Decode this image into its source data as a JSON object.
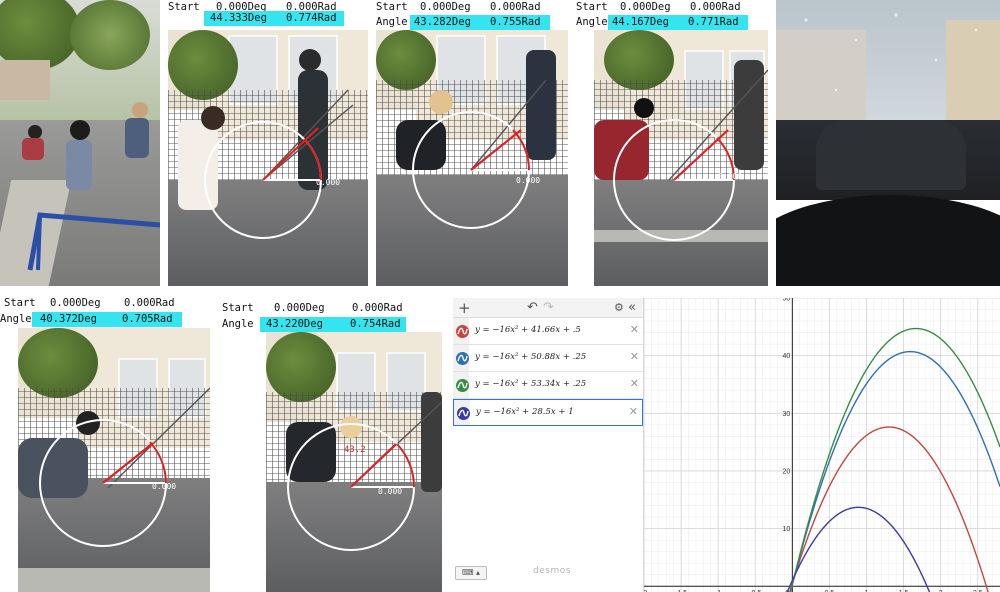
{
  "readouts": [
    {
      "id": "p2",
      "start_label": "Start",
      "start_deg": "0.000Deg",
      "start_rad": "0.000Rad",
      "angle_label": "Angle",
      "angle_deg": "44.333Deg",
      "angle_rad": "0.774Rad",
      "zero": "0.000"
    },
    {
      "id": "p3",
      "start_label": "Start",
      "start_deg": "0.000Deg",
      "start_rad": "0.000Rad",
      "angle_label": "Angle",
      "angle_deg": "43.282Deg",
      "angle_rad": "0.755Rad",
      "zero": "0.000"
    },
    {
      "id": "p4",
      "start_label": "Start",
      "start_deg": "0.000Deg",
      "start_rad": "0.000Rad",
      "angle_label": "Angle",
      "angle_deg": "44.167Deg",
      "angle_rad": "0.771Rad",
      "zero": "0.000"
    },
    {
      "id": "p6",
      "start_label": "Start",
      "start_deg": "0.000Deg",
      "start_rad": "0.000Rad",
      "angle_label": "Angle",
      "angle_deg": "40.372Deg",
      "angle_rad": "0.705Rad",
      "zero": "0.000"
    },
    {
      "id": "p7",
      "start_label": "Start",
      "start_deg": "0.000Deg",
      "start_rad": "0.000Rad",
      "angle_label": "Angle",
      "angle_deg": "43.220Deg",
      "angle_rad": "0.754Rad",
      "zero": "0.000",
      "arc_label": "43.2"
    }
  ],
  "desmos": {
    "toolbar": {
      "add": "+",
      "undo": "↶",
      "redo": "↷",
      "settings": "⚙",
      "collapse": "«"
    },
    "expressions": [
      {
        "latex": "y = −16x² + 41.66x + .5",
        "color": "#c74440"
      },
      {
        "latex": "y = −16x² + 50.88x + .25",
        "color": "#2d70b3"
      },
      {
        "latex": "y = −16x² + 53.34x + .25",
        "color": "#388c46"
      },
      {
        "latex": "y = −16x² + 28.5x + 1",
        "color": "#3b3ba8"
      }
    ],
    "keyboard_label": "⌨ ▴",
    "powered_by": "desmos"
  },
  "chart_data": {
    "type": "line",
    "xlim": [
      -2,
      2.8
    ],
    "ylim": [
      -1,
      50
    ],
    "x_ticks": [
      "-2",
      "-1.5",
      "-1",
      "-0.5",
      "0",
      "0.5",
      "1",
      "1.5",
      "2",
      "2.5"
    ],
    "y_ticks": [
      "10",
      "20",
      "30",
      "40",
      "50"
    ],
    "grid": true,
    "series": [
      {
        "a": -16,
        "b": 41.66,
        "c": 0.5,
        "color": "#c74440"
      },
      {
        "a": -16,
        "b": 50.88,
        "c": 0.25,
        "color": "#2d70b3"
      },
      {
        "a": -16,
        "b": 53.34,
        "c": 0.25,
        "color": "#388c46"
      },
      {
        "a": -16,
        "b": 28.5,
        "c": 1,
        "color": "#3b3ba8"
      }
    ]
  }
}
